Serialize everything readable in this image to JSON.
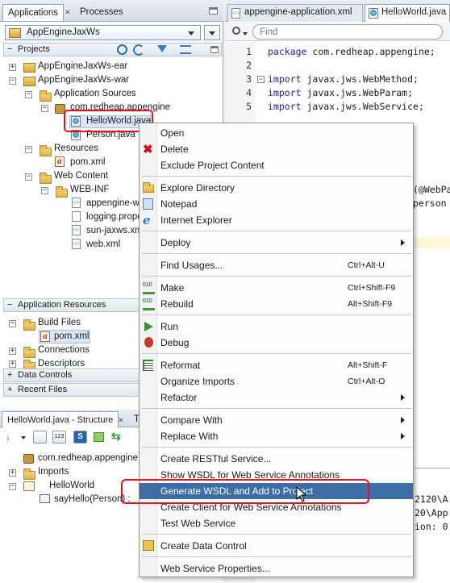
{
  "left_tabs": [
    "Applications",
    "Processes"
  ],
  "app_selector": "AppEngineJaxWs",
  "projects_header": "Projects",
  "tree": [
    {
      "label": "AppEngineJaxWs-ear"
    },
    {
      "label": "AppEngineJaxWs-war"
    },
    {
      "label": "Application Sources"
    },
    {
      "label": "com.redheap.appengine"
    },
    {
      "label": "HelloWorld.java"
    },
    {
      "label": "Person.java"
    },
    {
      "label": "Resources"
    },
    {
      "label": "pom.xml"
    },
    {
      "label": "Web Content"
    },
    {
      "label": "WEB-INF"
    },
    {
      "label": "appengine-we"
    },
    {
      "label": "logging.prope"
    },
    {
      "label": "sun-jaxws.xm"
    },
    {
      "label": "web.xml"
    }
  ],
  "app_resources": {
    "header": "Application Resources",
    "items": [
      "Build Files",
      "pom.xml",
      "Connections",
      "Descriptors"
    ]
  },
  "data_controls": "Data Controls",
  "recent_files": "Recent Files",
  "structure": {
    "tabs": [
      "HelloWorld.java - Structure",
      "T"
    ],
    "items": [
      "com.redheap.appengine",
      "Imports",
      "HelloWorld",
      "sayHello(Person) :"
    ]
  },
  "editor": {
    "tabs": [
      "appengine-application.xml",
      "HelloWorld.java"
    ],
    "find_placeholder": "Find",
    "line_numbers": [
      "1",
      "2",
      "3",
      "4",
      "5"
    ],
    "code": [
      {
        "kw": "package",
        "rest": " com.redheap.appengine;"
      },
      {
        "kw": "import",
        "rest": " javax.jws.WebMethod;"
      },
      {
        "kw": "import",
        "rest": " javax.jws.WebParam;"
      },
      {
        "kw": "import",
        "rest": " javax.jws.WebService;"
      }
    ],
    "partial": [
      "(@WebPa",
      "person",
      "2120\\A",
      "20\\App",
      "ion: 0"
    ]
  },
  "context_menu": [
    {
      "label": "Open",
      "shortcut": "",
      "icon": "none"
    },
    {
      "label": "Delete",
      "shortcut": "",
      "icon": "delete-icon"
    },
    {
      "label": "Exclude Project Content",
      "shortcut": "",
      "icon": "none"
    },
    {
      "label": "Explore Directory",
      "shortcut": "",
      "icon": "folder-icon"
    },
    {
      "label": "Notepad",
      "shortcut": "",
      "icon": "notepad-icon"
    },
    {
      "label": "Internet Explorer",
      "shortcut": "",
      "icon": "ie-icon"
    },
    {
      "label": "Deploy",
      "shortcut": "",
      "icon": "none"
    },
    {
      "label": "Find Usages...",
      "shortcut": "Ctrl+Alt-U",
      "icon": "none"
    },
    {
      "label": "Make",
      "shortcut": "Ctrl+Shift-F9",
      "icon": "make-icon"
    },
    {
      "label": "Rebuild",
      "shortcut": "Alt+Shift-F9",
      "icon": "rebuild-icon"
    },
    {
      "label": "Run",
      "shortcut": "",
      "icon": "run-icon"
    },
    {
      "label": "Debug",
      "shortcut": "",
      "icon": "debug-icon"
    },
    {
      "label": "Reformat",
      "shortcut": "Alt+Shift-F",
      "icon": "reformat-icon"
    },
    {
      "label": "Organize Imports",
      "shortcut": "Ctrl+Alt-O",
      "icon": "none"
    },
    {
      "label": "Refactor",
      "shortcut": "",
      "icon": "none"
    },
    {
      "label": "Compare With",
      "shortcut": "",
      "icon": "none"
    },
    {
      "label": "Replace With",
      "shortcut": "",
      "icon": "none"
    },
    {
      "label": "Create RESTful Service...",
      "shortcut": "",
      "icon": "none"
    },
    {
      "label": "Show WSDL for Web Service Annotations",
      "shortcut": "",
      "icon": "none"
    },
    {
      "label": "Generate WSDL and Add to Project",
      "shortcut": "",
      "icon": "none"
    },
    {
      "label": "Create Client for Web Service Annotations",
      "shortcut": "",
      "icon": "none"
    },
    {
      "label": "Test Web Service",
      "shortcut": "",
      "icon": "none"
    },
    {
      "label": "Create Data Control",
      "shortcut": "",
      "icon": "data-control-icon"
    },
    {
      "label": "Web Service Properties...",
      "shortcut": "",
      "icon": "none"
    }
  ],
  "colors": {
    "menu_highlight": "#3c6ea5",
    "callout_red": "#e8101a",
    "keyword_blue": "#1d24a8",
    "panel_header": "#dfe6ef"
  }
}
